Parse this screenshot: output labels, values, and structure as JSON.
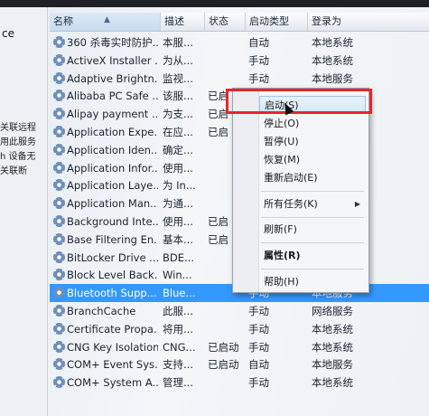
{
  "left_pane": {
    "title": "ce",
    "lines": [
      "关联远程",
      "用此服务",
      "h 设备无",
      "关联断"
    ]
  },
  "columns": {
    "name": "名称",
    "description": "描述",
    "status": "状态",
    "startup_type": "启动类型",
    "logon_as": "登录为"
  },
  "services": [
    {
      "name": "360 杀毒实时防护...",
      "desc": "本服...",
      "status": "",
      "start": "自动",
      "logon": "本地系统"
    },
    {
      "name": "ActiveX Installer ...",
      "desc": "为从...",
      "status": "",
      "start": "手动",
      "logon": "本地系统"
    },
    {
      "name": "Adaptive Brightn...",
      "desc": "监视...",
      "status": "",
      "start": "手动",
      "logon": "本地服务"
    },
    {
      "name": "Alibaba PC Safe ...",
      "desc": "该服...",
      "status": "已启",
      "start": "",
      "logon": ""
    },
    {
      "name": "Alipay payment ...",
      "desc": "为支...",
      "status": "已启",
      "start": "",
      "logon": ""
    },
    {
      "name": "Application Expe...",
      "desc": "在应...",
      "status": "已启",
      "start": "",
      "logon": ""
    },
    {
      "name": "Application Iden...",
      "desc": "确定...",
      "status": "",
      "start": "",
      "logon": ""
    },
    {
      "name": "Application Infor...",
      "desc": "使用...",
      "status": "",
      "start": "",
      "logon": ""
    },
    {
      "name": "Application Laye...",
      "desc": "为 In...",
      "status": "",
      "start": "",
      "logon": ""
    },
    {
      "name": "Application Man...",
      "desc": "为通...",
      "status": "",
      "start": "",
      "logon": ""
    },
    {
      "name": "Background Inte...",
      "desc": "使用...",
      "status": "已启",
      "start": "",
      "logon": ""
    },
    {
      "name": "Base Filtering En...",
      "desc": "基本...",
      "status": "已启",
      "start": "",
      "logon": ""
    },
    {
      "name": "BitLocker Drive ...",
      "desc": "BDE...",
      "status": "",
      "start": "",
      "logon": ""
    },
    {
      "name": "Block Level Back...",
      "desc": "Win...",
      "status": "",
      "start": "",
      "logon": ""
    },
    {
      "name": "Bluetooth Supp...",
      "desc": "Blue...",
      "status": "",
      "start": "手动",
      "logon": "本地服务"
    },
    {
      "name": "BranchCache",
      "desc": "此服...",
      "status": "",
      "start": "手动",
      "logon": "网络服务"
    },
    {
      "name": "Certificate Propa...",
      "desc": "将用...",
      "status": "",
      "start": "手动",
      "logon": "本地系统"
    },
    {
      "name": "CNG Key Isolation",
      "desc": "CNG...",
      "status": "已启动",
      "start": "手动",
      "logon": "本地系统"
    },
    {
      "name": "COM+ Event Sys...",
      "desc": "支持...",
      "status": "已启动",
      "start": "自动",
      "logon": "本地服务"
    },
    {
      "name": "COM+ System A...",
      "desc": "管理...",
      "status": "",
      "start": "手动",
      "logon": "本地系统"
    }
  ],
  "selected_row": 14,
  "context_menu": {
    "items": [
      {
        "label": "启动(S)",
        "highlighted": true
      },
      {
        "label": "停止(O)"
      },
      {
        "label": "暂停(U)"
      },
      {
        "label": "恢复(M)"
      },
      {
        "label": "重新启动(E)"
      },
      {
        "label": "所有任务(K)",
        "submenu": true
      },
      {
        "label": "刷新(F)"
      },
      {
        "label": "属性(R)",
        "bold": true
      },
      {
        "label": "帮助(H)"
      }
    ],
    "submenu_arrow": "▶"
  },
  "colors": {
    "selection": "#3399ff",
    "annotation_box": "#e8262a"
  }
}
